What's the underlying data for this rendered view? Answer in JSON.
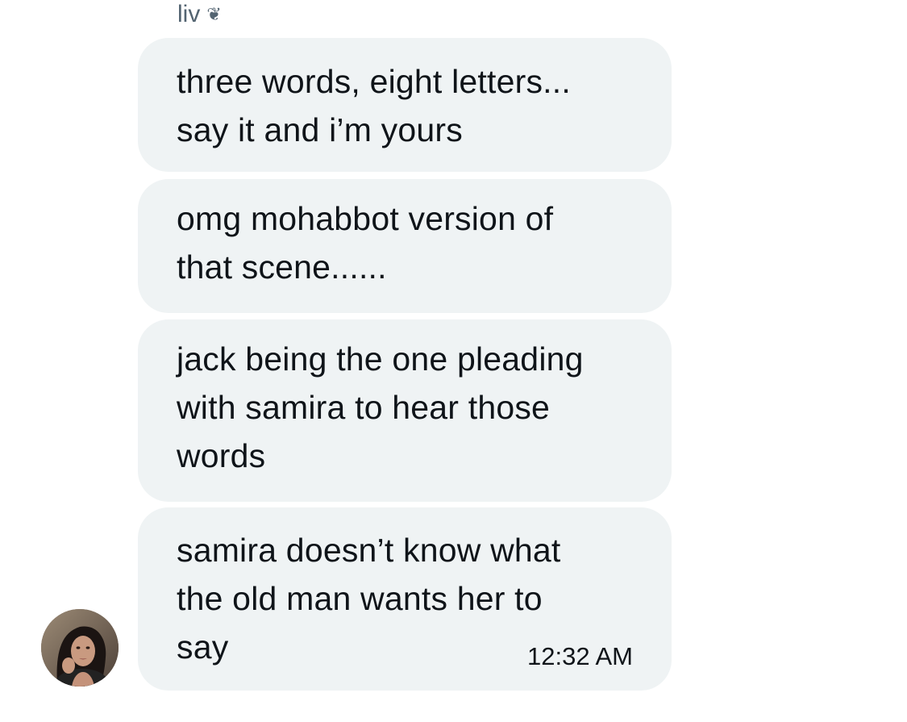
{
  "sender": {
    "name": "liv",
    "badge": "❦"
  },
  "messages": [
    {
      "text": "three words, eight letters...\nsay it and i’m yours"
    },
    {
      "text": "omg mohabbot version of\nthat scene......"
    },
    {
      "text": "jack being the one pleading\nwith samira to hear those\nwords"
    },
    {
      "text": "samira doesn’t know what\nthe old man wants her to\nsay",
      "timestamp": "12:32 AM"
    }
  ],
  "avatar": {
    "icon": "profile-photo"
  },
  "colors": {
    "bubble": "#eff3f4",
    "text": "#0f1419",
    "muted": "#536471",
    "background": "#ffffff"
  }
}
